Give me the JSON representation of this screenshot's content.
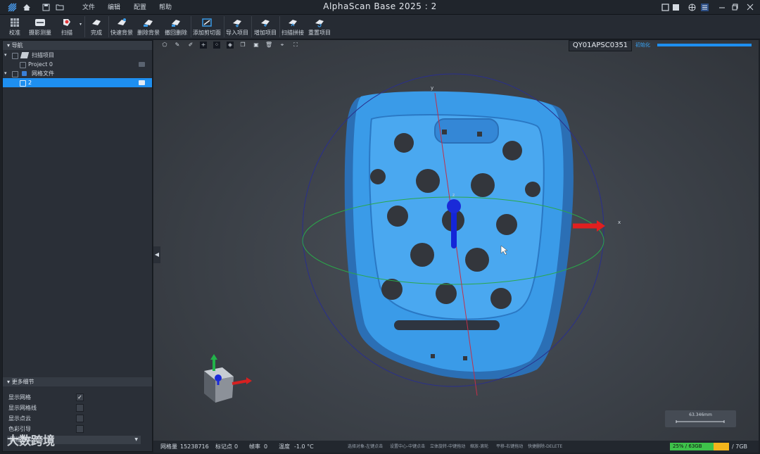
{
  "titlebar": {
    "title": "AlphaScan Base 2025 : 2",
    "menus": [
      "文件",
      "编辑",
      "配置",
      "帮助"
    ]
  },
  "toolbar": {
    "items": [
      {
        "label": "校准",
        "icon": "grid-icon"
      },
      {
        "label": "摄影测量",
        "icon": "camera-icon"
      },
      {
        "label": "扫描",
        "icon": "scan-icon"
      },
      {
        "label": "完成",
        "icon": "finish-icon"
      },
      {
        "label": "快速背景",
        "icon": "quick-background-icon"
      },
      {
        "label": "删除背景",
        "icon": "delete-background-icon"
      },
      {
        "label": "撤回删除",
        "icon": "undo-delete-icon"
      },
      {
        "label": "添加剪切面",
        "icon": "cut-plane-icon"
      },
      {
        "label": "导入项目",
        "icon": "import-icon"
      },
      {
        "label": "增加项目",
        "icon": "add-project-icon"
      },
      {
        "label": "扫描拼接",
        "icon": "stitch-icon"
      },
      {
        "label": "重置项目",
        "icon": "reset-icon"
      }
    ]
  },
  "navigator": {
    "title": "导航",
    "tree": [
      {
        "label": "扫描项目",
        "level": 0
      },
      {
        "label": "Project 0",
        "level": 1
      },
      {
        "label": "网格文件",
        "level": 0
      },
      {
        "label": "2",
        "level": 1,
        "selected": true
      }
    ]
  },
  "details": {
    "title": "更多细节",
    "options": [
      {
        "label": "显示网格",
        "checked": true
      },
      {
        "label": "显示网格线",
        "checked": false
      },
      {
        "label": "显示点云",
        "checked": false
      },
      {
        "label": "色彩引导",
        "checked": false
      }
    ],
    "dropdown_value": "网格渲染"
  },
  "viewport": {
    "device_id": "QY01APSC0351",
    "init_label": "初始化",
    "progress": 1.0,
    "axis_x": "x",
    "axis_y": "y",
    "axis_z": "z",
    "scale_label": "63.346mm"
  },
  "status": {
    "grid_label": "网格量",
    "grid_value": "15238716",
    "marker_label": "标记点",
    "marker_value": "0",
    "fps_label": "帧率",
    "fps_value": "0",
    "temp_label": "温度",
    "temp_value": "-1.0 °C",
    "hints": [
      "选择对象-左键点击",
      "设置中心-中键点击",
      "立体旋转-中键拖动",
      "缩放-滚轮",
      "平移-右键拖动",
      "快捷删除-DELETE"
    ],
    "mem1": "25% / 63GB",
    "mem2": "/ 7GB"
  },
  "watermark": "大数跨境",
  "colors": {
    "accent": "#1e8ff0",
    "model": "#3a9be8",
    "mem1": "#3ec24a",
    "mem2": "#f3b51c"
  }
}
